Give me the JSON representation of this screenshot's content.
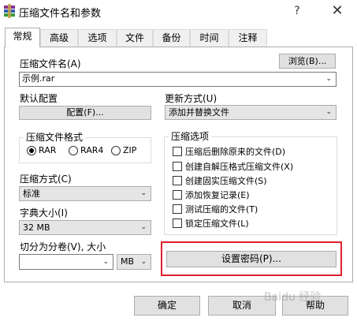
{
  "window": {
    "title": "压缩文件名和参数",
    "help": "?",
    "close": "✕"
  },
  "tabs": [
    "常规",
    "高级",
    "选项",
    "文件",
    "备份",
    "时间",
    "注释"
  ],
  "archive_name": {
    "label": "压缩文件名(A)",
    "browse": "浏览(B)...",
    "value": "示例.rar"
  },
  "default_profile": {
    "label": "默认配置",
    "button": "配置(F)..."
  },
  "update_mode": {
    "label": "更新方式(U)",
    "value": "添加并替换文件"
  },
  "archive_format": {
    "title": "压缩文件格式",
    "options": [
      "RAR",
      "RAR4",
      "ZIP"
    ],
    "selected": "RAR"
  },
  "compression_method": {
    "label": "压缩方式(C)",
    "value": "标准"
  },
  "dictionary_size": {
    "label": "字典大小(I)",
    "value": "32 MB"
  },
  "split_volumes": {
    "label": "切分为分卷(V), 大小",
    "value": "",
    "unit": "MB"
  },
  "archive_options": {
    "title": "压缩选项",
    "items": [
      {
        "label": "压缩后删除原来的文件(D)",
        "checked": false
      },
      {
        "label": "创建自解压格式压缩文件(X)",
        "checked": false
      },
      {
        "label": "创建固实压缩文件(S)",
        "checked": false
      },
      {
        "label": "添加恢复记录(E)",
        "checked": false
      },
      {
        "label": "测试压缩的文件(T)",
        "checked": false
      },
      {
        "label": "锁定压缩文件(L)",
        "checked": false
      }
    ]
  },
  "set_password": {
    "label": "设置密码(P)...",
    "highlight_color": "#e0202c"
  },
  "footer": {
    "ok": "确定",
    "cancel": "取消",
    "help": "帮助"
  },
  "watermark": "Baidu 经验"
}
